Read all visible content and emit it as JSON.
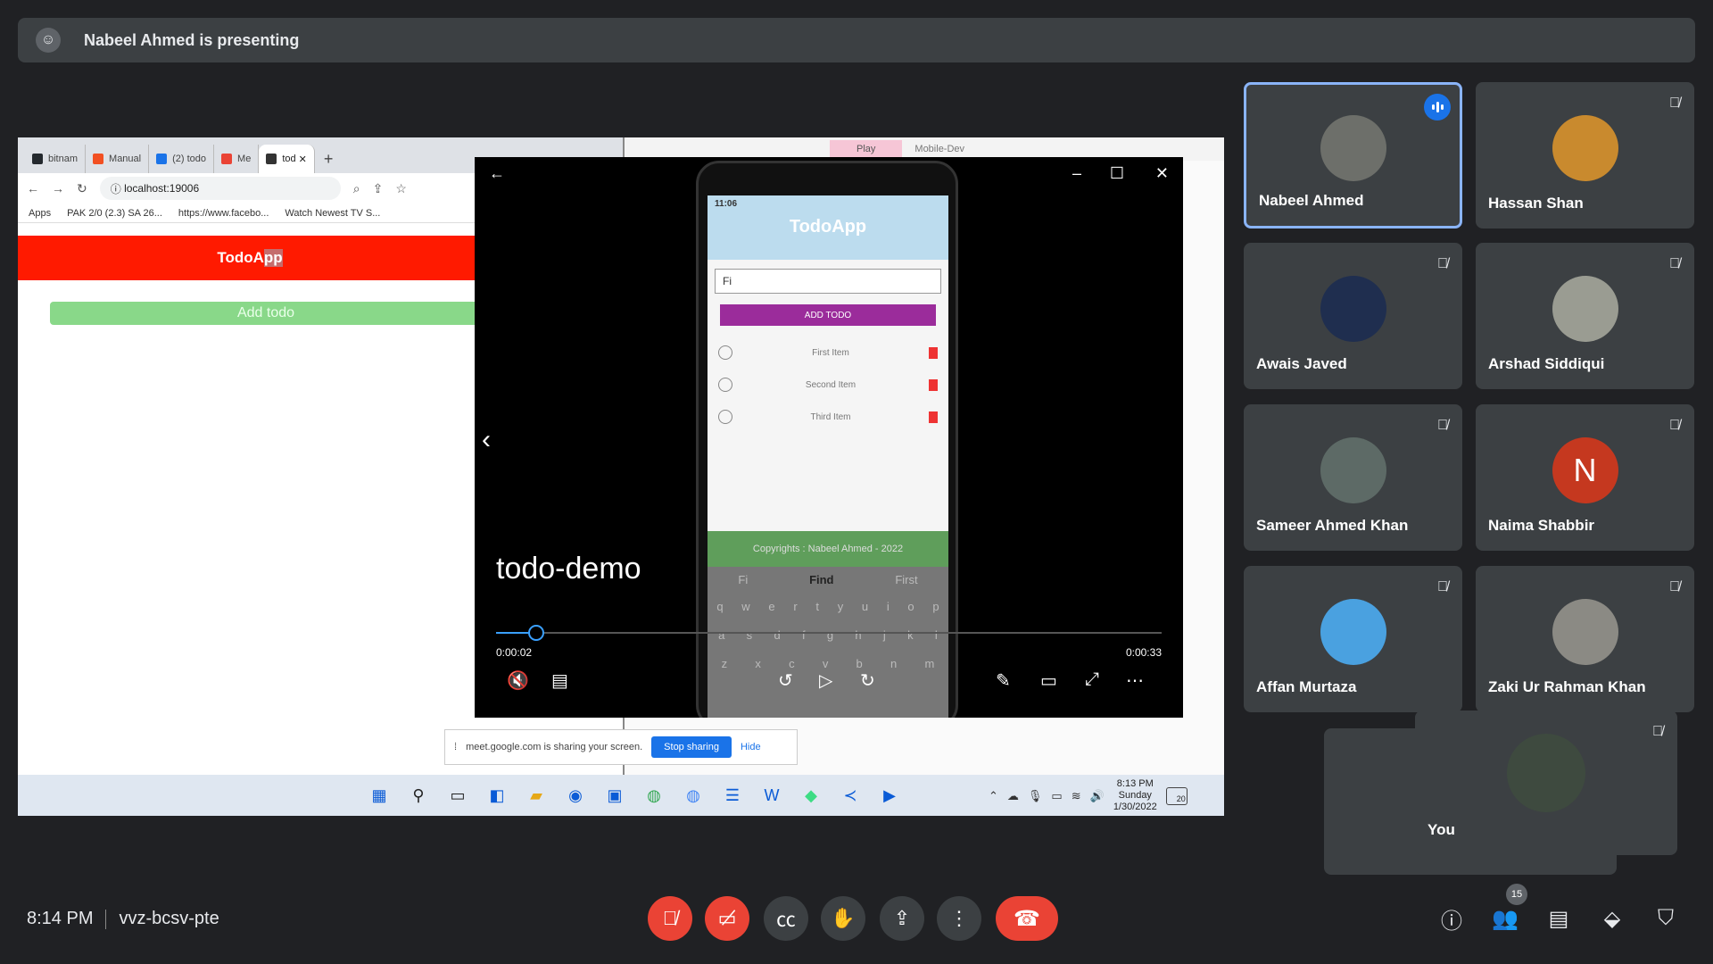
{
  "banner": {
    "text": "Nabeel Ahmed is presenting"
  },
  "browser": {
    "tabs": [
      {
        "label": "bitnam",
        "color": "#24292e"
      },
      {
        "label": "Manual",
        "color": "#f25022"
      },
      {
        "label": "(2) todo",
        "color": "#1a73e8"
      },
      {
        "label": "Me",
        "color": "#ea4335"
      },
      {
        "label": "tod",
        "color": "#333333"
      }
    ],
    "url": "localhost:19006",
    "bookmarks": [
      "Apps",
      "PAK 2/0 (2.3) SA 26...",
      "https://www.facebo...",
      "Watch Newest TV S..."
    ]
  },
  "todo_app": {
    "title_a": "TodoA",
    "title_b": "pp",
    "add_button": "Add todo"
  },
  "right_window": {
    "tab_play": "Play",
    "tab_dev": "Mobile-Dev"
  },
  "phone": {
    "time": "11:06",
    "app_title": "TodoApp",
    "input_value": "Fi",
    "add_button": "ADD TODO",
    "items": [
      "First Item",
      "Second Item",
      "Third Item"
    ],
    "footer": "Copyrights : Nabeel Ahmed - 2022",
    "suggestions": [
      "Fi",
      "Find",
      "First"
    ],
    "kb_row1": [
      "q",
      "w",
      "e",
      "r",
      "t",
      "y",
      "u",
      "i",
      "o",
      "p"
    ],
    "kb_row2": [
      "a",
      "s",
      "d",
      "f",
      "g",
      "h",
      "j",
      "k",
      "l"
    ],
    "kb_row3": [
      "z",
      "x",
      "c",
      "v",
      "b",
      "n",
      "m"
    ]
  },
  "player": {
    "title": "todo-demo",
    "current": "0:00:02",
    "total": "0:00:33",
    "progress": 0.06
  },
  "share_bar": {
    "text": "meet.google.com is sharing your screen.",
    "stop": "Stop sharing",
    "hide": "Hide"
  },
  "taskbar": {
    "time": "8:13 PM",
    "day": "Sunday",
    "date": "1/30/2022",
    "notifications": "20"
  },
  "participants": [
    {
      "name": "Nabeel Ahmed",
      "color": "#6d6f6a",
      "speaking": true
    },
    {
      "name": "Hassan Shan",
      "color": "#c98a2e",
      "speaking": false
    },
    {
      "name": "Awais Javed",
      "color": "#1f2e4f",
      "speaking": false
    },
    {
      "name": "Arshad Siddiqui",
      "color": "#9a9c92",
      "speaking": false
    },
    {
      "name": "Sameer Ahmed Khan",
      "color": "#5d6a66",
      "speaking": false
    },
    {
      "name": "Naima Shabbir",
      "color": "#c5381f",
      "initial": "N",
      "speaking": false
    },
    {
      "name": "Affan Murtaza",
      "color": "#4aa1e0",
      "speaking": false
    },
    {
      "name": "Zaki Ur Rahman Khan",
      "color": "#8b8a84",
      "speaking": false
    }
  ],
  "self": {
    "name": "You",
    "color": "#3e4a3f"
  },
  "meeting": {
    "time": "8:14 PM",
    "code": "vvz-bcsv-pte",
    "participant_count": "15"
  }
}
